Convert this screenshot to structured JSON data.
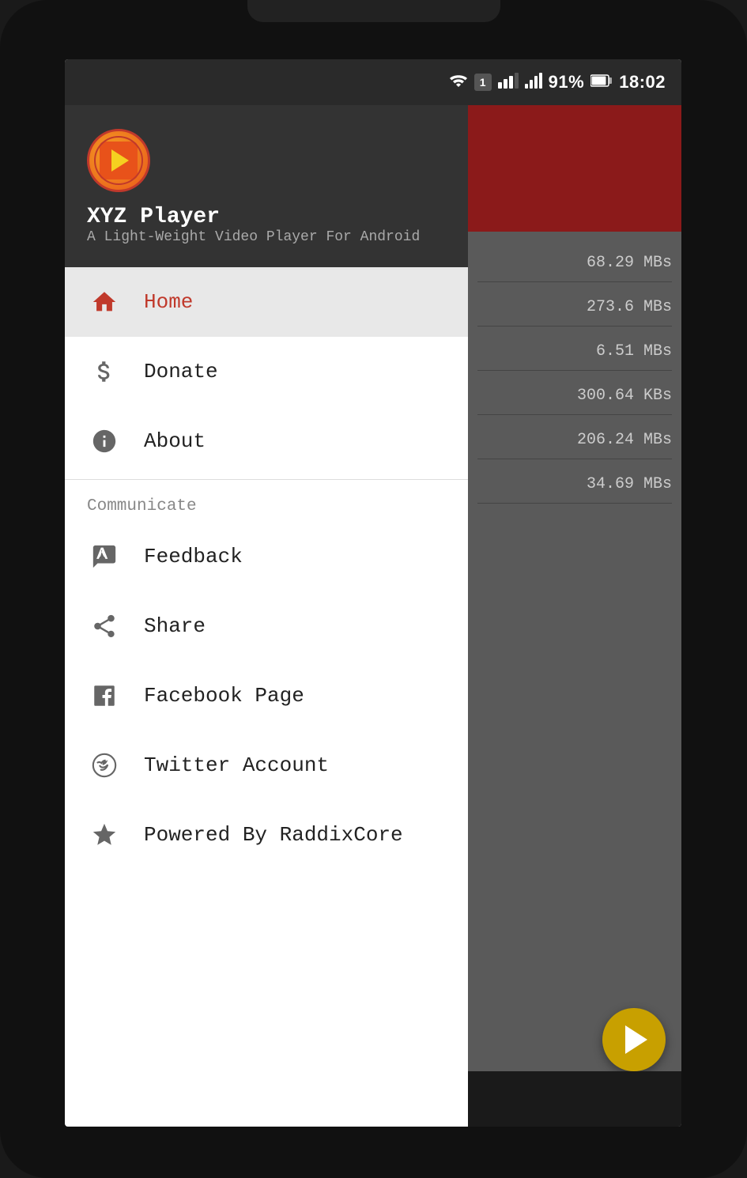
{
  "status_bar": {
    "battery": "91%",
    "time": "18:02",
    "charging": true
  },
  "app": {
    "name": "XYZ Player",
    "subtitle": "A Light-Weight Video Player For Android",
    "logo_alt": "XYZ Player Logo"
  },
  "menu": {
    "home_label": "Home",
    "donate_label": "Donate",
    "about_label": "About",
    "communicate_section": "Communicate",
    "feedback_label": "Feedback",
    "share_label": "Share",
    "facebook_label": "Facebook Page",
    "twitter_label": "Twitter Account",
    "powered_label": "Powered By RaddixCore"
  },
  "right_panel": {
    "sizes": [
      "68.29 MBs",
      "273.6 MBs",
      "6.51 MBs",
      "300.64 KBs",
      "206.24 MBs",
      "34.69 MBs"
    ]
  },
  "colors": {
    "accent": "#c0392b",
    "dark_header": "#333333",
    "active_bg": "#e8e8e8",
    "gray_icon": "#666666",
    "section_text": "#888888",
    "dark_right_top": "#8b1a1a",
    "fab": "#c8a000"
  }
}
